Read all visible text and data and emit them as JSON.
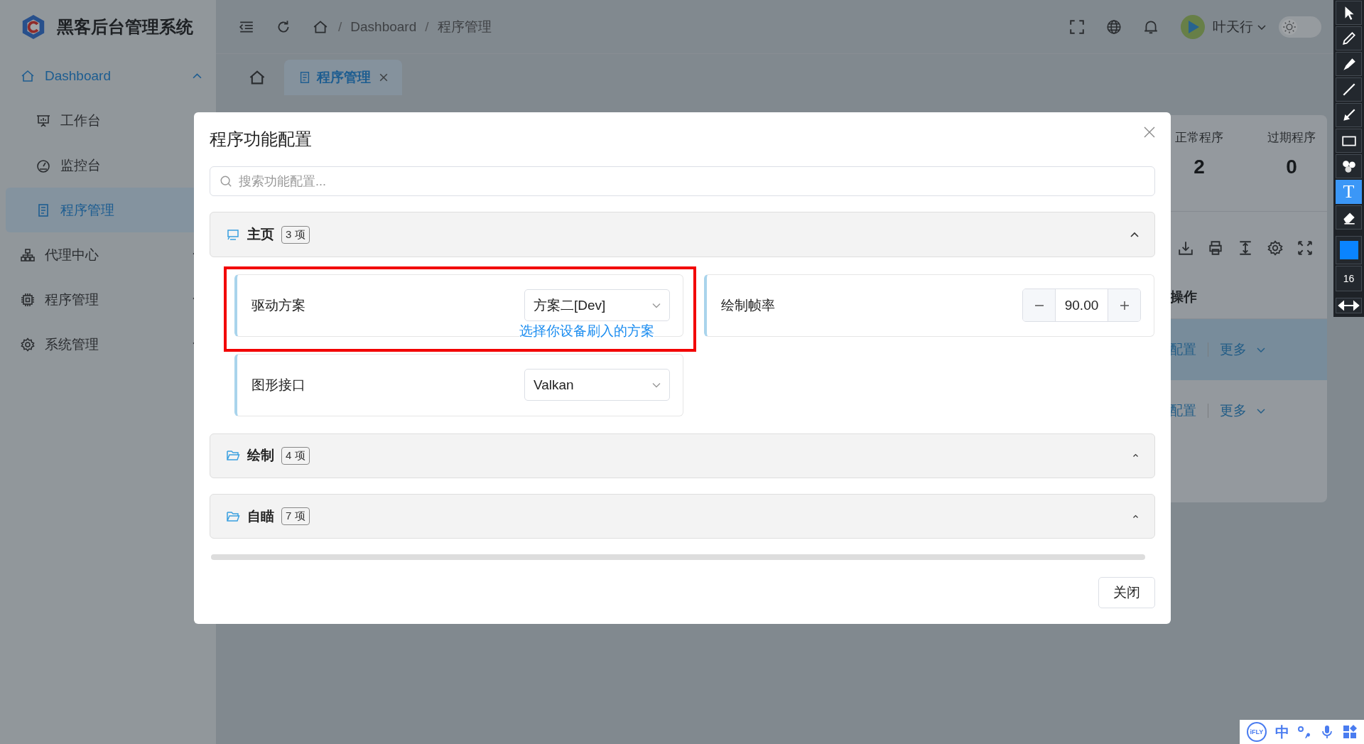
{
  "app": {
    "title": "黑客后台管理系统"
  },
  "header": {
    "breadcrumb": [
      {
        "separator": "/",
        "label": "Dashboard"
      },
      {
        "separator": "/",
        "label": "程序管理"
      }
    ],
    "user": {
      "name": "叶天行"
    },
    "dark_mode": false
  },
  "sidebar": {
    "items": [
      {
        "label": "Dashboard",
        "expanded": true,
        "selected": false,
        "children": [
          {
            "label": "工作台",
            "selected": false
          },
          {
            "label": "监控台",
            "selected": false
          },
          {
            "label": "程序管理",
            "selected": true
          }
        ]
      },
      {
        "label": "代理中心",
        "expanded": false,
        "selected": false
      },
      {
        "label": "程序管理",
        "expanded": false,
        "selected": false
      },
      {
        "label": "系统管理",
        "expanded": false,
        "selected": false
      }
    ]
  },
  "tabs": [
    {
      "kind": "home",
      "selected": false
    },
    {
      "kind": "page",
      "label": "程序管理",
      "selected": true
    }
  ],
  "page": {
    "stats": [
      {
        "label": "正常程序",
        "value": "2"
      },
      {
        "label": "过期程序",
        "value": "0"
      }
    ],
    "table": {
      "columns": [
        "操作"
      ],
      "rows": [
        {
          "actions": [
            "配置",
            "更多"
          ],
          "selected": true
        },
        {
          "actions": [
            "配置",
            "更多"
          ],
          "selected": false
        }
      ]
    }
  },
  "dialog": {
    "title": "程序功能配置",
    "search": {
      "placeholder": "搜索功能配置..."
    },
    "sections": [
      {
        "title": "主页",
        "count": "3 项",
        "expanded": true,
        "items": [
          {
            "kind": "select",
            "label": "驱动方案",
            "value": "方案二[Dev]",
            "hint": "选择你设备刷入的方案",
            "highlighted": true
          },
          {
            "kind": "number",
            "label": "绘制帧率",
            "value": "90.00",
            "highlighted": false
          },
          {
            "kind": "select",
            "label": "图形接口",
            "value": "Valkan",
            "highlighted": false
          }
        ]
      },
      {
        "title": "绘制",
        "count": "4 项",
        "expanded": false
      },
      {
        "title": "自瞄",
        "count": "7 项",
        "expanded": false
      }
    ],
    "buttons": [
      "关闭"
    ]
  },
  "annotation_toolbar": {
    "tools": [
      {
        "kind": "cursor",
        "selected": false
      },
      {
        "kind": "pencil",
        "selected": false
      },
      {
        "kind": "marker",
        "selected": false
      },
      {
        "kind": "line",
        "selected": false
      },
      {
        "kind": "arrow",
        "selected": false
      },
      {
        "kind": "rectangle",
        "selected": false
      },
      {
        "kind": "counter",
        "selected": false
      },
      {
        "kind": "text",
        "label": "T",
        "selected": true
      },
      {
        "kind": "eraser",
        "selected": false
      }
    ],
    "size": "16"
  },
  "ime_bar": {
    "logo": "iFLY",
    "mode": "中"
  }
}
